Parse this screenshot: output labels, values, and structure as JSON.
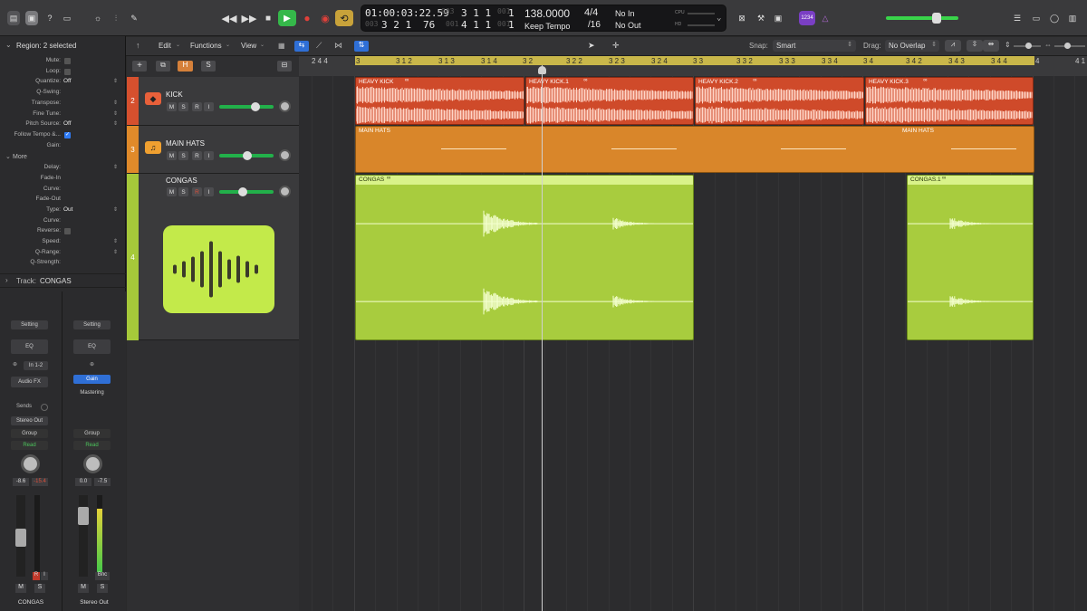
{
  "toolbar": {
    "lcd": {
      "time": "01:00:03:22.59",
      "time_dim": "003",
      "bars_top": "3  1  1",
      "bars_top_dim": "001",
      "bars_top_ticks": "1",
      "bars_bottom": "3  2  1",
      "bars_bottom_val": "76",
      "bars_bottom_dim": "003",
      "bars_bottom2": "4  1  1",
      "bars_bottom2_dim": "001",
      "bars_bottom2_ticks": "1",
      "tempo": "138.0000",
      "tempo_mode": "Keep Tempo",
      "signature": "4/4",
      "division": "/16",
      "midi_in": "No In",
      "midi_out": "No Out",
      "cpu_label": "CPU",
      "hd_label": "HD"
    },
    "badge": "1234"
  },
  "arrange_toolbar": {
    "edit": "Edit",
    "functions": "Functions",
    "view": "View",
    "snap_label": "Snap:",
    "snap_value": "Smart",
    "drag_label": "Drag:",
    "drag_value": "No Overlap"
  },
  "inspector": {
    "region_header": "Region: 2 selected",
    "rows": [
      {
        "label": "Mute:",
        "value": ""
      },
      {
        "label": "Loop:",
        "value": ""
      },
      {
        "label": "Quantize:",
        "value": "Off"
      },
      {
        "label": "Q-Swing:",
        "value": ""
      },
      {
        "label": "Transpose:",
        "value": ""
      },
      {
        "label": "Fine Tune:",
        "value": ""
      },
      {
        "label": "Pitch Source:",
        "value": "Off"
      },
      {
        "label": "Follow Tempo &...",
        "value": ""
      },
      {
        "label": "Gain:",
        "value": ""
      }
    ],
    "more_label": "More",
    "more_rows": [
      {
        "label": "Delay:",
        "value": ""
      },
      {
        "label": "Fade-In",
        "value": ""
      },
      {
        "label": "Curve:",
        "value": ""
      },
      {
        "label": "Fade-Out",
        "value": ""
      },
      {
        "label": "Type:",
        "value": "Out"
      },
      {
        "label": "Curve:",
        "value": ""
      },
      {
        "label": "Reverse:",
        "value": ""
      },
      {
        "label": "Speed:",
        "value": ""
      },
      {
        "label": "Q-Range:",
        "value": ""
      },
      {
        "label": "Q-Strength:",
        "value": ""
      }
    ],
    "track_header_label": "Track:",
    "track_header_value": "CONGAS"
  },
  "strips": [
    {
      "setting": "Setting",
      "eq": "EQ",
      "input": "In 1-2",
      "fx": "Audio FX",
      "sends": "Sends",
      "output": "Stereo Out",
      "group": "Group",
      "automation": "Read",
      "pan_l": "-8.6",
      "pan_r": "-15.4",
      "name": "CONGAS",
      "m": "M",
      "s": "S",
      "r": "R",
      "i": "I"
    },
    {
      "setting": "Setting",
      "eq": "EQ",
      "input": "",
      "fx": "Gain",
      "fx2": "Mastering",
      "output": "",
      "group": "Group",
      "automation": "Read",
      "pan_l": "0.0",
      "pan_r": "-7.5",
      "name": "Stereo Out",
      "m": "M",
      "s": "S",
      "bnc": "Bnc"
    }
  ],
  "tracks": [
    {
      "num": "2",
      "name": "KICK",
      "color": "#d6502e"
    },
    {
      "num": "3",
      "name": "MAIN HATS",
      "color": "#e08a2a"
    },
    {
      "num": "4",
      "name": "CONGAS",
      "color": "#a6c93a"
    }
  ],
  "track_buttons": {
    "m": "M",
    "s": "S",
    "r": "R",
    "i": "I",
    "h": "H",
    "solo": "S"
  },
  "ruler": [
    "2 4 4",
    "3",
    "3 1 2",
    "3 1 3",
    "3 1 4",
    "3 2",
    "3 2 2",
    "3 2 3",
    "3 2 4",
    "3 3",
    "3 3 2",
    "3 3 3",
    "3 3 4",
    "3 4",
    "3 4 2",
    "3 4 3",
    "3 4 4",
    "4",
    "4 1"
  ],
  "regions": {
    "kick": [
      "HEAVY KICK",
      "HEAVY KICK.1",
      "HEAVY KICK.2",
      "HEAVY KICK.3"
    ],
    "hats": [
      "MAIN HATS",
      "MAIN HATS"
    ],
    "congas": [
      "CONGAS",
      "CONGAS.1"
    ]
  },
  "colors": {
    "kick": "#cf4a2a",
    "hats": "#d9862a",
    "congas": "#a8cc3e",
    "ruler_region": "#c9b74a",
    "play": "#35b84a",
    "record": "#e0403a"
  }
}
